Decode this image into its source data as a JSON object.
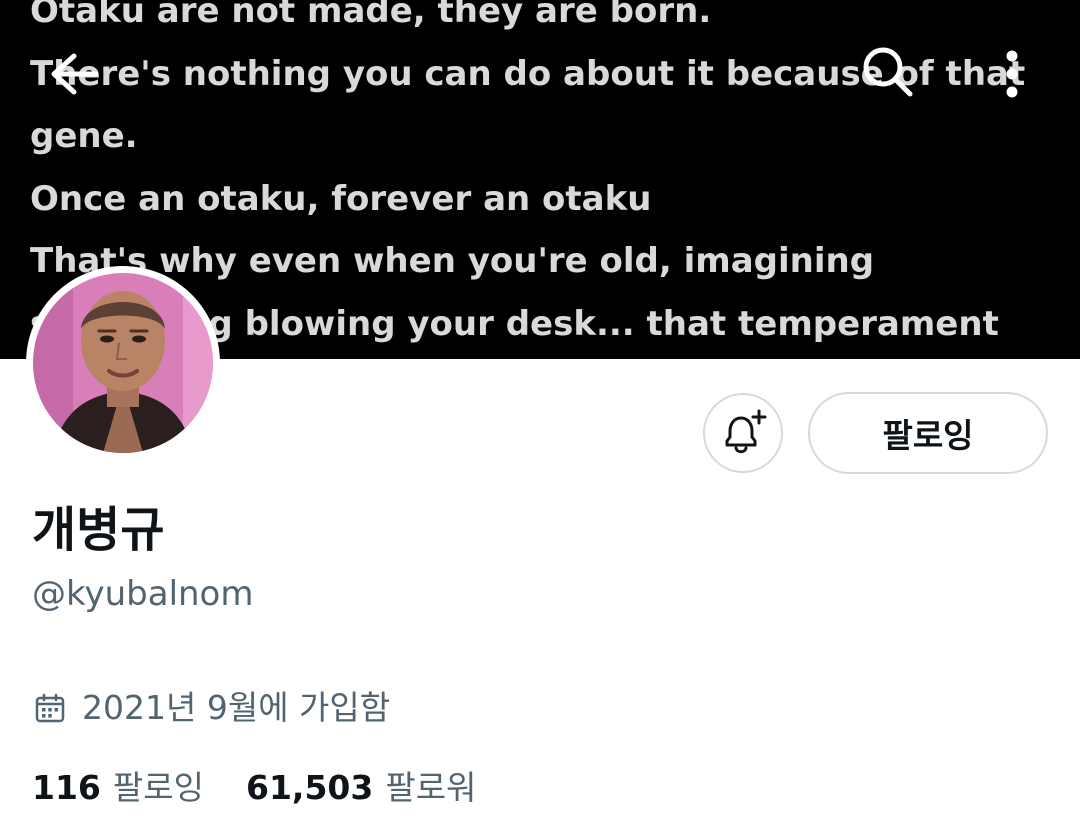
{
  "banner": {
    "lines": [
      "Otaku are not made, they are born.",
      "There's nothing you can do about it because of that",
      "gene.",
      "Once an otaku, forever an otaku",
      "That's why even when you're old, imagining",
      "something blowing your desk... that temperament"
    ]
  },
  "nav": {
    "back_icon": "arrow-left-icon",
    "search_icon": "search-icon",
    "more_icon": "more-vertical-icon"
  },
  "profile": {
    "display_name": "개병규",
    "handle": "@kyubalnom",
    "join_date": "2021년 9월에 가입함",
    "join_icon": "calendar-icon",
    "following_count": "116",
    "following_label": "팔로잉",
    "followers_count": "61,503",
    "followers_label": "팔로워"
  },
  "actions": {
    "notify_icon": "bell-plus-icon",
    "follow_label": "팔로잉"
  },
  "colors": {
    "banner_bg": "#000000",
    "banner_text": "#d9d9d9",
    "primary_text": "#0f1419",
    "secondary_text": "#536471",
    "button_border": "#d6dadd"
  }
}
